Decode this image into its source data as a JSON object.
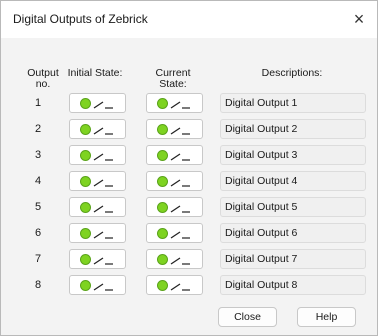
{
  "dialog": {
    "title": "Digital Outputs of Zebrick",
    "close_glyph": "×"
  },
  "headers": {
    "output_no_line1": "Output",
    "output_no_line2": "no.",
    "initial_state": "Initial State:",
    "current_line1": "Current",
    "current_line2": "State:",
    "descriptions": "Descriptions:"
  },
  "rows": [
    {
      "no": "1",
      "description": "Digital Output 1",
      "initial_on": true,
      "current_on": true
    },
    {
      "no": "2",
      "description": "Digital Output 2",
      "initial_on": true,
      "current_on": true
    },
    {
      "no": "3",
      "description": "Digital Output 3",
      "initial_on": true,
      "current_on": true
    },
    {
      "no": "4",
      "description": "Digital Output 4",
      "initial_on": true,
      "current_on": true
    },
    {
      "no": "5",
      "description": "Digital Output 5",
      "initial_on": true,
      "current_on": true
    },
    {
      "no": "6",
      "description": "Digital Output 6",
      "initial_on": true,
      "current_on": true
    },
    {
      "no": "7",
      "description": "Digital Output 7",
      "initial_on": true,
      "current_on": true
    },
    {
      "no": "8",
      "description": "Digital Output 8",
      "initial_on": true,
      "current_on": true
    }
  ],
  "buttons": {
    "close": "Close",
    "help": "Help"
  },
  "colors": {
    "led_on": "#7ed321",
    "dialog_bg": "#f3f3f3"
  }
}
